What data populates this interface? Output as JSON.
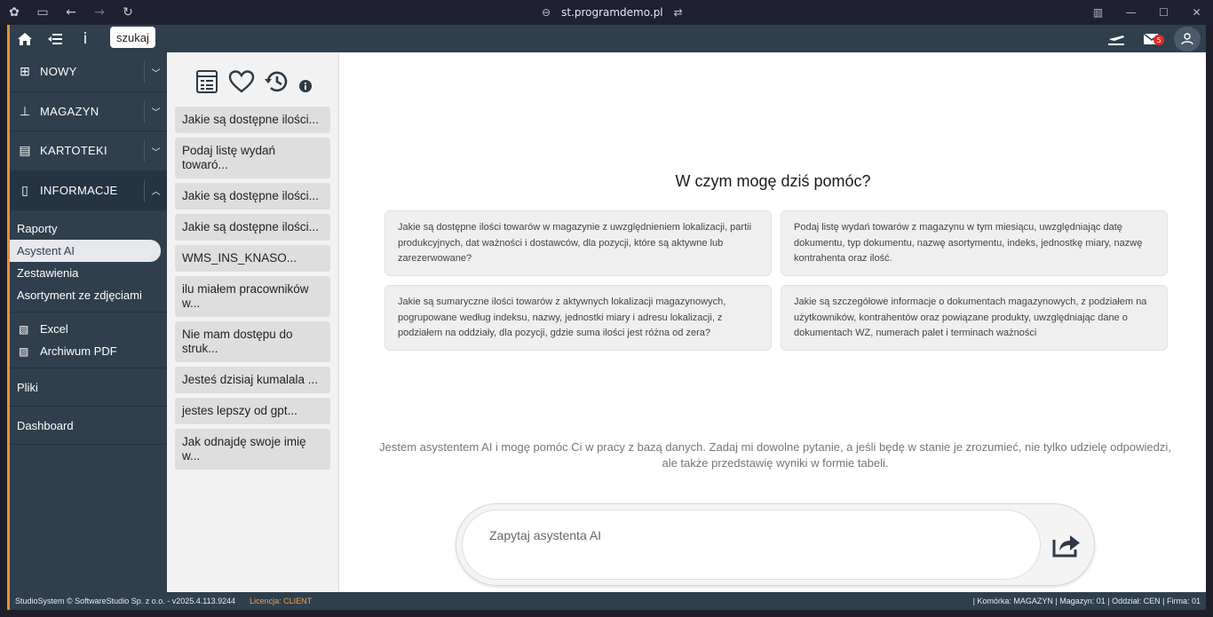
{
  "browser": {
    "url": "st.programdemo.pl"
  },
  "topbar": {
    "search_tooltip": "szukaj",
    "mail_count": "5"
  },
  "sidebar": {
    "sections": [
      {
        "label": "NOWY"
      },
      {
        "label": "MAGAZYN"
      },
      {
        "label": "KARTOTEKI"
      },
      {
        "label": "INFORMACJE"
      }
    ],
    "sub_items": [
      "Raporty",
      "Asystent AI",
      "Zestawienia",
      "Asortyment ze zdjęciami"
    ],
    "export_items": [
      "Excel",
      "Archiwum PDF"
    ],
    "extra_items": [
      "Pliki",
      "Dashboard"
    ]
  },
  "history": {
    "items": [
      "Jakie są dostępne ilości...",
      "Podaj listę wydań towaró...",
      "Jakie są dostępne ilości...",
      "Jakie są dostępne ilości...",
      "WMS_INS_KNASO...",
      "ilu miałem pracowników w...",
      "Nie mam dostępu do struk...",
      "Jesteś dzisiaj kumalala ...",
      "jestes lepszy od gpt...",
      "Jak odnajdę swoje imię w..."
    ]
  },
  "main": {
    "welcome": "W czym mogę dziś pomóc?",
    "suggestions": [
      "Jakie są dostępne ilości towarów w magazynie z uwzględnieniem lokalizacji, partii produkcyjnych, dat ważności i dostawców, dla pozycji, które są aktywne lub zarezerwowane?",
      "Podaj listę wydań towarów z magazynu w tym miesiącu, uwzględniając datę dokumentu, typ dokumentu, nazwę asortymentu, indeks, jednostkę miary, nazwę kontrahenta oraz ilość.",
      "Jakie są sumaryczne ilości towarów z aktywnych lokalizacji magazynowych, pogrupowane według indeksu, nazwy, jednostki miary i adresu lokalizacji, z podziałem na oddziały, dla pozycji, gdzie suma ilości jest różna od zera?",
      "Jakie są szczegółowe informacje o dokumentach magazynowych, z podziałem na użytkowników, kontrahentów oraz powiązane produkty, uwzględniając dane o dokumentach WZ, numerach palet i terminach ważności"
    ],
    "intro": "Jestem asystentem AI i mogę pomóc Ci w pracy z bazą danych. Zadaj mi dowolne pytanie, a jeśli będę w stanie je zrozumieć, nie tylko udzielę odpowiedzi, ale także przedstawię wyniki w formie tabeli.",
    "input_placeholder": "Zapytaj asystenta AI"
  },
  "statusbar": {
    "left": "StudioSystem © SoftwareStudio Sp. z o.o. - v2025.4.113.9244",
    "license": "Licencja: CLIENT",
    "right": "| Komórka: MAGAZYN | Magazyn: 01 | Oddział: CEN | Firma: 01"
  },
  "colors": {
    "sidebar": "#2f3f4d",
    "accent": "#e8902e",
    "badge": "#e02a2a"
  }
}
